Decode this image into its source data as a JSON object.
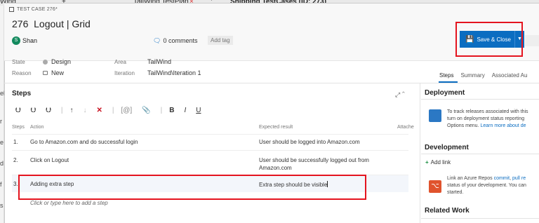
{
  "background": {
    "wind_text": "Wind",
    "plus": "+",
    "tab_text": "TailWind TestPlan",
    "close": "×",
    "more": ":",
    "page_title": "Shipping TestCases (ID: 273)",
    "left_letters": [
      "el",
      "r",
      "e",
      "d",
      "f",
      "s"
    ]
  },
  "header": {
    "test_case_label": "TEST CASE 276*",
    "id": "276",
    "title": "Logout | Grid",
    "user_initial": "S",
    "user_name": "Shan",
    "comments": "0 comments",
    "add_tag": "Add tag",
    "save_close": "Save & Close"
  },
  "fields": {
    "state_label": "State",
    "state_value": "Design",
    "reason_label": "Reason",
    "reason_value": "New",
    "area_label": "Area",
    "area_value": "TailWind",
    "iteration_label": "Iteration",
    "iteration_value": "TailWind\\Iteration 1"
  },
  "tabs": [
    "Steps",
    "Summary",
    "Associated Au"
  ],
  "steps": {
    "heading": "Steps",
    "columns": {
      "steps": "Steps",
      "action": "Action",
      "expected": "Expected result",
      "attach": "Attache"
    },
    "rows": [
      {
        "num": "1.",
        "action": "Go to Amazon.com and do successful login",
        "expected": "User should be logged into Amazon.com"
      },
      {
        "num": "2.",
        "action": "Click on Logout",
        "expected": "User should be successfully logged out from",
        "expected2": "Amazon.com"
      },
      {
        "num": "3.",
        "action": "Adding extra step",
        "expected": "Extra step should be visible"
      }
    ],
    "add_placeholder": "Click or type here to add a step"
  },
  "side": {
    "deployment": "Deployment",
    "deploy_text1": "To track releases associated with this",
    "deploy_text2": "turn on deployment status reporting",
    "deploy_text3": "Options menu.",
    "deploy_link": "Learn more about de",
    "development": "Development",
    "add_link": "Add link",
    "dev_text1a": "Link an Azure Repos",
    "dev_link1": "commit",
    "dev_link2": "pull re",
    "dev_text2": "status of your development. You can",
    "dev_text3": "started.",
    "related": "Related Work"
  },
  "colors": {
    "accent": "#0b6dc1",
    "highlight": "#e4141f",
    "delete": "#c8101f"
  }
}
